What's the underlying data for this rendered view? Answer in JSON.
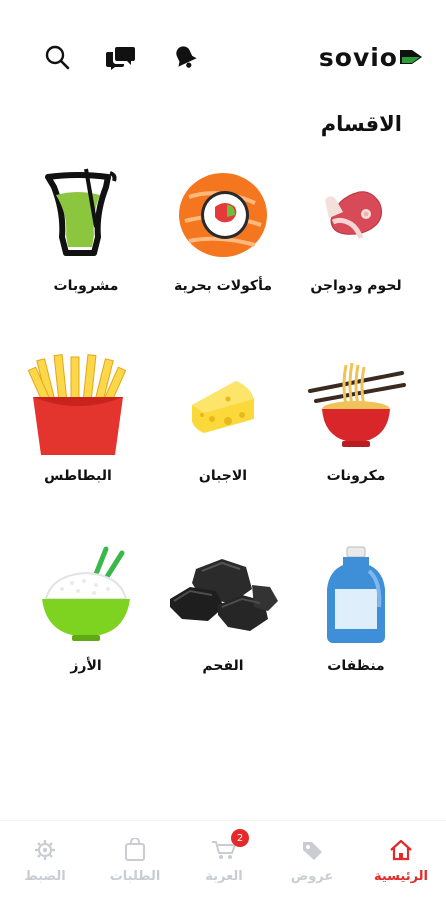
{
  "app": {
    "logo_text": "sovio"
  },
  "header": {
    "icons": [
      "search-icon",
      "chat-icon",
      "bell-icon"
    ]
  },
  "section": {
    "title": "الاقسام"
  },
  "categories": [
    {
      "label": "لحوم ودواجن",
      "icon": "meat-icon"
    },
    {
      "label": "مأكولات بحرية",
      "icon": "sushi-icon"
    },
    {
      "label": "مشروبات",
      "icon": "drink-icon"
    },
    {
      "label": "مكرونات",
      "icon": "noodles-icon"
    },
    {
      "label": "الاجبان",
      "icon": "cheese-icon"
    },
    {
      "label": "البطاطس",
      "icon": "fries-icon"
    },
    {
      "label": "منظفات",
      "icon": "detergent-icon"
    },
    {
      "label": "الفحم",
      "icon": "charcoal-icon"
    },
    {
      "label": "الأرز",
      "icon": "rice-icon"
    }
  ],
  "bottom_nav": {
    "items": [
      {
        "label": "الرئيسية",
        "icon": "home-icon",
        "active": true
      },
      {
        "label": "عروض",
        "icon": "tag-icon"
      },
      {
        "label": "العربة",
        "icon": "cart-icon",
        "badge": "2"
      },
      {
        "label": "الطلبات",
        "icon": "bag-icon"
      },
      {
        "label": "الضبط",
        "icon": "gear-icon"
      }
    ]
  },
  "colors": {
    "accent": "#e32929",
    "logo_green": "#2e9b3b",
    "inactive": "#c9cdd3"
  }
}
